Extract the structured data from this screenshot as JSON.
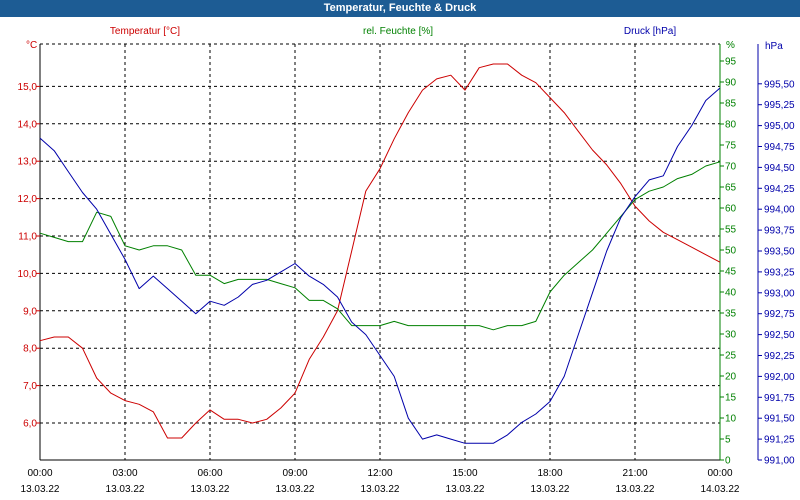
{
  "title": "Temperatur, Feuchte & Druck",
  "colors": {
    "temperature": "#cc0000",
    "humidity": "#008000",
    "pressure": "#0000aa",
    "titlebar": "#1d5c94",
    "grid": "#000000"
  },
  "chart_data": {
    "type": "line",
    "title": "Temperatur, Feuchte & Druck",
    "grid": true,
    "x_ticks": [
      {
        "time": "00:00",
        "date": "13.03.22"
      },
      {
        "time": "03:00",
        "date": "13.03.22"
      },
      {
        "time": "06:00",
        "date": "13.03.22"
      },
      {
        "time": "09:00",
        "date": "13.03.22"
      },
      {
        "time": "12:00",
        "date": "13.03.22"
      },
      {
        "time": "15:00",
        "date": "13.03.22"
      },
      {
        "time": "18:00",
        "date": "13.03.22"
      },
      {
        "time": "21:00",
        "date": "13.03.22"
      },
      {
        "time": "00:00",
        "date": "14.03.22"
      }
    ],
    "xlim": [
      "13.03.22 00:00",
      "14.03.22 00:00"
    ],
    "axes": {
      "temperature": {
        "label": "Temperatur [°C]",
        "unit": "°C",
        "ylim": [
          5.0,
          16.0
        ],
        "ticks": [
          "6,0",
          "7,0",
          "8,0",
          "9,0",
          "10,0",
          "11,0",
          "12,0",
          "13,0",
          "14,0",
          "15,0"
        ]
      },
      "humidity": {
        "label": "rel. Feuchte [%]",
        "unit": "%",
        "ylim": [
          0,
          100
        ],
        "ticks": [
          "0",
          "5",
          "10",
          "15",
          "20",
          "25",
          "30",
          "35",
          "40",
          "45",
          "50",
          "55",
          "60",
          "65",
          "70",
          "75",
          "80",
          "85",
          "90",
          "95"
        ]
      },
      "pressure": {
        "label": "Druck [hPa]",
        "unit": "hPa",
        "ylim": [
          991.0,
          995.5
        ],
        "ticks": [
          "991,00",
          "991,25",
          "991,50",
          "991,75",
          "992,00",
          "992,25",
          "992,50",
          "992,75",
          "993,00",
          "993,25",
          "993,50",
          "993,75",
          "994,00",
          "994,25",
          "994,50",
          "994,75",
          "995,00",
          "995,25",
          "995,50"
        ]
      }
    },
    "series": [
      {
        "name": "Temperatur [°C]",
        "axis": "temperature",
        "x": [
          "00:00",
          "00:30",
          "01:00",
          "01:30",
          "02:00",
          "02:30",
          "03:00",
          "03:30",
          "04:00",
          "04:30",
          "05:00",
          "05:30",
          "06:00",
          "06:30",
          "07:00",
          "07:30",
          "08:00",
          "08:30",
          "09:00",
          "09:30",
          "10:00",
          "10:30",
          "11:00",
          "11:30",
          "12:00",
          "12:30",
          "13:00",
          "13:30",
          "14:00",
          "14:30",
          "15:00",
          "15:30",
          "16:00",
          "16:30",
          "17:00",
          "17:30",
          "18:00",
          "18:30",
          "19:00",
          "19:30",
          "20:00",
          "20:30",
          "21:00",
          "21:30",
          "22:00",
          "22:30",
          "23:00",
          "23:30",
          "24:00"
        ],
        "values": [
          8.2,
          8.3,
          8.3,
          8.0,
          7.2,
          6.8,
          6.6,
          6.5,
          6.3,
          5.6,
          5.6,
          6.0,
          6.35,
          6.1,
          6.1,
          6.0,
          6.1,
          6.4,
          6.8,
          7.7,
          8.3,
          9.0,
          10.6,
          12.2,
          12.8,
          13.6,
          14.3,
          14.9,
          15.2,
          15.3,
          14.9,
          15.5,
          15.6,
          15.6,
          15.3,
          15.1,
          14.7,
          14.3,
          13.8,
          13.3,
          12.9,
          12.4,
          11.8,
          11.4,
          11.1,
          10.9,
          10.7,
          10.5,
          10.3
        ]
      },
      {
        "name": "rel. Feuchte [%]",
        "axis": "humidity",
        "x": [
          "00:00",
          "00:30",
          "01:00",
          "01:30",
          "02:00",
          "02:30",
          "03:00",
          "03:30",
          "04:00",
          "04:30",
          "05:00",
          "05:30",
          "06:00",
          "06:30",
          "07:00",
          "07:30",
          "08:00",
          "08:30",
          "09:00",
          "09:30",
          "10:00",
          "10:30",
          "11:00",
          "11:30",
          "12:00",
          "12:30",
          "13:00",
          "13:30",
          "14:00",
          "14:30",
          "15:00",
          "15:30",
          "16:00",
          "16:30",
          "17:00",
          "17:30",
          "18:00",
          "18:30",
          "19:00",
          "19:30",
          "20:00",
          "20:30",
          "21:00",
          "21:30",
          "22:00",
          "22:30",
          "23:00",
          "23:30",
          "24:00"
        ],
        "values": [
          54,
          53,
          52,
          52,
          59,
          58,
          51,
          50,
          51,
          51,
          50,
          44,
          44,
          42,
          43,
          43,
          43,
          42,
          41,
          38,
          38,
          36,
          32,
          32,
          32,
          33,
          32,
          32,
          32,
          32,
          32,
          32,
          31,
          32,
          32,
          33,
          40,
          44,
          47,
          50,
          54,
          58,
          62,
          64,
          65,
          67,
          68,
          70,
          71
        ]
      },
      {
        "name": "Druck [hPa]",
        "axis": "pressure",
        "x": [
          "00:00",
          "00:30",
          "01:00",
          "01:30",
          "02:00",
          "02:30",
          "03:00",
          "03:30",
          "04:00",
          "04:30",
          "05:00",
          "05:30",
          "06:00",
          "06:30",
          "07:00",
          "07:30",
          "08:00",
          "08:30",
          "09:00",
          "09:30",
          "10:00",
          "10:30",
          "11:00",
          "11:30",
          "12:00",
          "12:30",
          "13:00",
          "13:30",
          "14:00",
          "14:30",
          "15:00",
          "15:30",
          "16:00",
          "16:30",
          "17:00",
          "17:30",
          "18:00",
          "18:30",
          "19:00",
          "19:30",
          "20:00",
          "20:30",
          "21:00",
          "21:30",
          "22:00",
          "22:30",
          "23:00",
          "23:30",
          "24:00"
        ],
        "values": [
          994.85,
          994.7,
          994.45,
          994.2,
          994.0,
          993.7,
          993.4,
          993.05,
          993.2,
          993.05,
          992.9,
          992.75,
          992.9,
          992.85,
          992.95,
          993.1,
          993.15,
          993.25,
          993.35,
          993.2,
          993.1,
          992.95,
          992.65,
          992.5,
          992.25,
          992.0,
          991.5,
          991.25,
          991.3,
          991.25,
          991.2,
          991.2,
          991.2,
          991.3,
          991.45,
          991.55,
          991.7,
          992.0,
          992.5,
          993.0,
          993.5,
          993.9,
          994.15,
          994.35,
          994.4,
          994.75,
          995.0,
          995.3,
          995.45
        ]
      }
    ]
  }
}
